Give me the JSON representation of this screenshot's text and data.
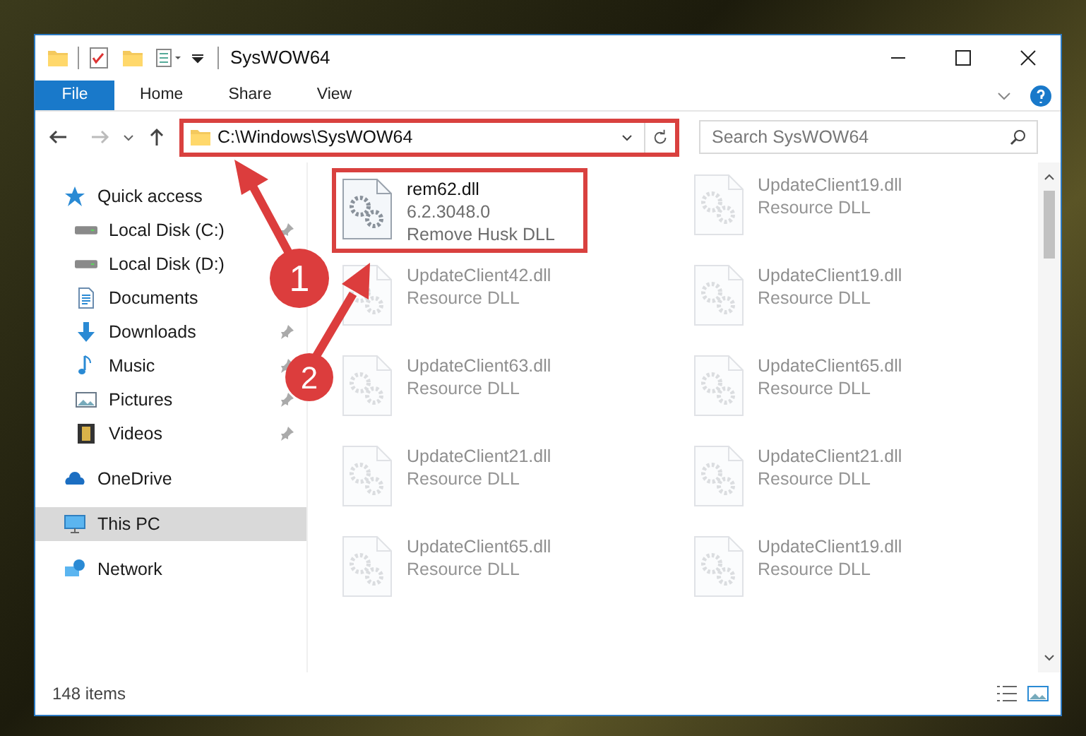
{
  "window": {
    "title": "SysWOW64"
  },
  "ribbon_tabs": [
    {
      "label": "File",
      "selected": true
    },
    {
      "label": "Home",
      "selected": false
    },
    {
      "label": "Share",
      "selected": false
    },
    {
      "label": "View",
      "selected": false
    }
  ],
  "address": {
    "path": "C:\\Windows\\SysWOW64",
    "highlighted": true
  },
  "search": {
    "placeholder": "Search SysWOW64"
  },
  "navigation": [
    {
      "label": "Quick access",
      "selected": false,
      "children": [
        {
          "label": "Local Disk (C:)",
          "pinned": true,
          "selected": false
        },
        {
          "label": "Local Disk (D:)",
          "pinned": false,
          "selected": false
        },
        {
          "label": "Documents",
          "pinned": false,
          "selected": false
        },
        {
          "label": "Downloads",
          "pinned": true,
          "selected": false
        },
        {
          "label": "Music",
          "pinned": true,
          "selected": false
        },
        {
          "label": "Pictures",
          "pinned": true,
          "selected": false
        },
        {
          "label": "Videos",
          "pinned": true,
          "selected": false
        }
      ]
    },
    {
      "label": "OneDrive",
      "selected": false
    },
    {
      "label": "This PC",
      "selected": true
    },
    {
      "label": "Network",
      "selected": false
    }
  ],
  "files": [
    {
      "name": "rem62.dll",
      "details": [
        "6.2.3048.0",
        "Remove Husk DLL"
      ],
      "faded": false,
      "highlighted": true
    },
    {
      "name": "UpdateClient19.dll",
      "details": [
        "Resource DLL"
      ],
      "faded": true
    },
    {
      "name": "UpdateClient42.dll",
      "details": [
        "Resource DLL"
      ],
      "faded": true
    },
    {
      "name": "UpdateClient19.dll",
      "details": [
        "Resource DLL"
      ],
      "faded": true
    },
    {
      "name": "UpdateClient63.dll",
      "details": [
        "Resource DLL"
      ],
      "faded": true
    },
    {
      "name": "UpdateClient65.dll",
      "details": [
        "Resource DLL"
      ],
      "faded": true
    },
    {
      "name": "UpdateClient21.dll",
      "details": [
        "Resource DLL"
      ],
      "faded": true
    },
    {
      "name": "UpdateClient21.dll",
      "details": [
        "Resource DLL"
      ],
      "faded": true
    },
    {
      "name": "UpdateClient65.dll",
      "details": [
        "Resource DLL"
      ],
      "faded": true
    },
    {
      "name": "UpdateClient19.dll",
      "details": [
        "Resource DLL"
      ],
      "faded": true
    }
  ],
  "status_bar": {
    "item_count": "148 items"
  },
  "annotations": [
    {
      "number": "1"
    },
    {
      "number": "2"
    }
  ]
}
